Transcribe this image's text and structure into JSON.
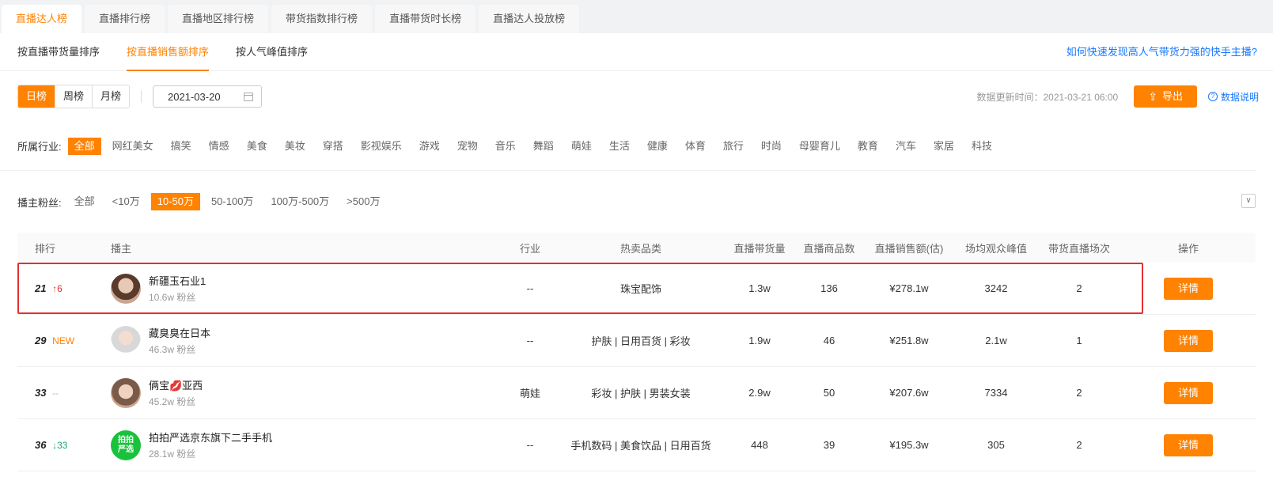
{
  "top_tabs": [
    "直播达人榜",
    "直播排行榜",
    "直播地区排行榜",
    "带货指数排行榜",
    "直播带货时长榜",
    "直播达人投放榜"
  ],
  "sub_tabs": [
    "按直播带货量排序",
    "按直播销售额排序",
    "按人气峰值排序"
  ],
  "help_link": "如何快速发现高人气带货力强的快手主播?",
  "period": [
    "日榜",
    "周榜",
    "月榜"
  ],
  "date": "2021-03-20",
  "update_time": "数据更新时间：2021-03-21 06:00",
  "export_label": "导出",
  "explain_label": "数据说明",
  "industry": {
    "label": "所属行业:",
    "options": [
      "全部",
      "网红美女",
      "搞笑",
      "情感",
      "美食",
      "美妆",
      "穿搭",
      "影视娱乐",
      "游戏",
      "宠物",
      "音乐",
      "舞蹈",
      "萌娃",
      "生活",
      "健康",
      "体育",
      "旅行",
      "时尚",
      "母婴育儿",
      "教育",
      "汽车",
      "家居",
      "科技"
    ]
  },
  "fans": {
    "label": "播主粉丝:",
    "options": [
      "全部",
      "<10万",
      "10-50万",
      "50-100万",
      "100万-500万",
      ">500万"
    ]
  },
  "table": {
    "headers": {
      "rank": "排行",
      "host": "播主",
      "industry": "行业",
      "category": "热卖品类",
      "volume": "直播带货量",
      "items": "直播商品数",
      "sales": "直播销售额(估)",
      "peak": "场均观众峰值",
      "sessions": "带货直播场次",
      "op": "操作"
    },
    "rows": [
      {
        "rank": "21",
        "change": "↑6",
        "name": "新疆玉石业1",
        "fans": "10.6w 粉丝",
        "industry": "--",
        "category": "珠宝配饰",
        "volume": "1.3w",
        "items": "136",
        "sales": "¥278.1w",
        "peak": "3242",
        "sessions": "2",
        "btn": "详情"
      },
      {
        "rank": "29",
        "change": "NEW",
        "name": "藏臭臭在日本",
        "fans": "46.3w 粉丝",
        "industry": "--",
        "category": "护肤 | 日用百货 | 彩妆",
        "volume": "1.9w",
        "items": "46",
        "sales": "¥251.8w",
        "peak": "2.1w",
        "sessions": "1",
        "btn": "详情"
      },
      {
        "rank": "33",
        "change": "--",
        "name": "俩宝💋亚西",
        "fans": "45.2w 粉丝",
        "industry": "萌娃",
        "category": "彩妆 | 护肤 | 男装女装",
        "volume": "2.9w",
        "items": "50",
        "sales": "¥207.6w",
        "peak": "7334",
        "sessions": "2",
        "btn": "详情"
      },
      {
        "rank": "36",
        "change": "↓33",
        "name": "拍拍严选京东旗下二手手机",
        "fans": "28.1w 粉丝",
        "industry": "--",
        "category": "手机数码 | 美食饮品 | 日用百货",
        "volume": "448",
        "items": "39",
        "sales": "¥195.3w",
        "peak": "305",
        "sessions": "2",
        "btn": "详情"
      }
    ]
  },
  "logo_text": [
    "拍拍",
    "严选"
  ]
}
